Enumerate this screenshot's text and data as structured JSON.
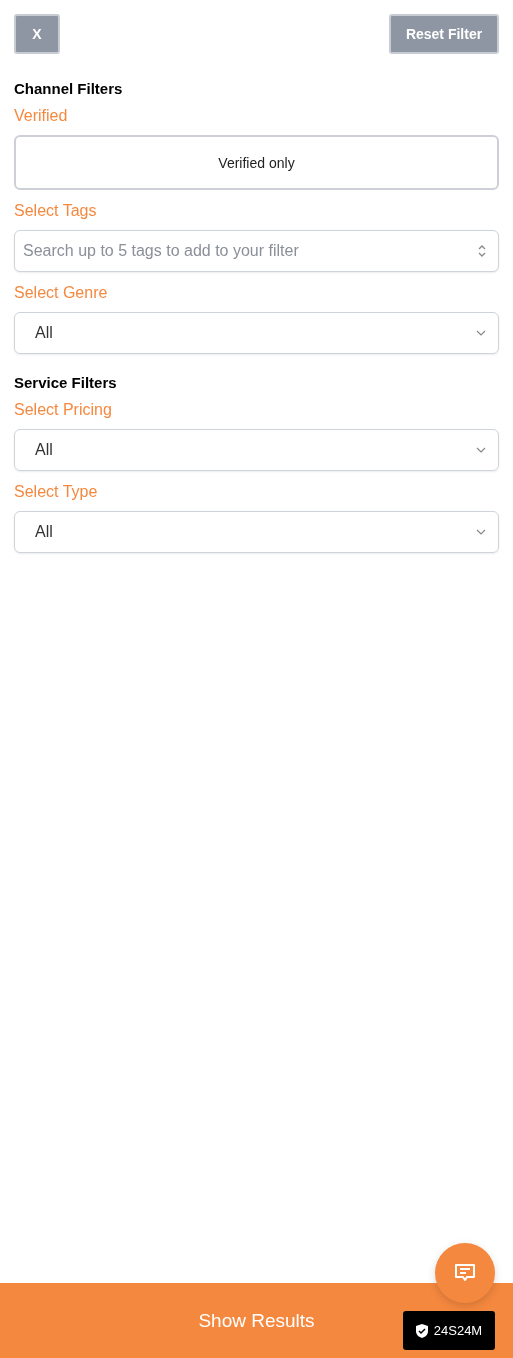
{
  "top_bar": {
    "close_button": "X",
    "reset_button": "Reset Filter"
  },
  "sections": [
    {
      "heading": "Channel Filters",
      "fields": [
        {
          "label": "Verified",
          "kind": "toggle",
          "text": "Verified only"
        },
        {
          "label": "Select Tags",
          "kind": "combobox",
          "placeholder": "Search up to 5 tags to add to your filter"
        },
        {
          "label": "Select Genre",
          "kind": "select",
          "value": "All"
        }
      ]
    },
    {
      "heading": "Service Filters",
      "fields": [
        {
          "label": "Select Pricing",
          "kind": "select",
          "value": "All"
        },
        {
          "label": "Select Type",
          "kind": "select",
          "value": "All"
        }
      ]
    }
  ],
  "footer": {
    "button": "Show Results",
    "badge": "24S24M"
  }
}
